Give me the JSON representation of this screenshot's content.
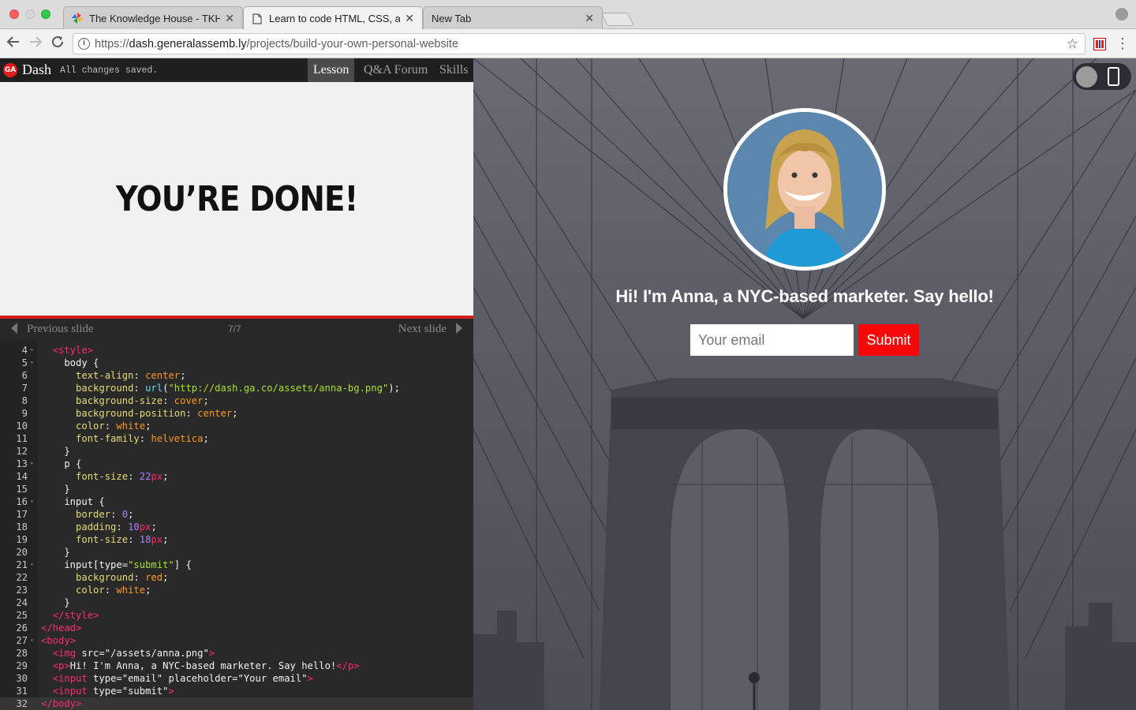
{
  "browser": {
    "tabs": [
      {
        "title": "The Knowledge House - TKH - ",
        "active": false
      },
      {
        "title": "Learn to code HTML, CSS, and",
        "active": true
      },
      {
        "title": "New Tab",
        "active": false
      }
    ],
    "url_prefix": "https://",
    "url_host": "dash.generalassemb.ly",
    "url_path": "/projects/build-your-own-personal-website"
  },
  "dash": {
    "logo": "GA",
    "title": "Dash",
    "status": "All changes saved.",
    "tabs": [
      "Lesson",
      "Q&A Forum",
      "Skills"
    ]
  },
  "slide": {
    "heading": "YOU’RE DONE!",
    "prev_label": "Previous slide",
    "next_label": "Next slide",
    "counter": "7/7"
  },
  "editor": {
    "line_numbers": [
      "4",
      "5",
      "6",
      "7",
      "8",
      "9",
      "10",
      "11",
      "12",
      "13",
      "14",
      "15",
      "16",
      "17",
      "18",
      "19",
      "20",
      "21",
      "22",
      "23",
      "24",
      "25",
      "26",
      "27",
      "28",
      "29",
      "30",
      "31",
      "32"
    ],
    "lines": [
      "  <style>",
      "    body {",
      "      text-align: center;",
      "      background: url(\"http://dash.ga.co/assets/anna-bg.png\");",
      "      background-size: cover;",
      "      background-position: center;",
      "      color: white;",
      "      font-family: helvetica;",
      "    }",
      "    p {",
      "      font-size: 22px;",
      "    }",
      "    input {",
      "      border: 0;",
      "      padding: 10px;",
      "      font-size: 18px;",
      "    }",
      "    input[type=\"submit\"] {",
      "      background: red;",
      "      color: white;",
      "    }",
      "  </style>",
      "</head>",
      "<body>",
      "  <img src=\"/assets/anna.png\">",
      "  <p>Hi! I'm Anna, a NYC-based marketer. Say hello!</p>",
      "  <input type=\"email\" placeholder=\"Your email\">",
      "  <input type=\"submit\">",
      "</body>"
    ]
  },
  "preview": {
    "greeting": "Hi! I'm Anna, a NYC-based marketer. Say hello!",
    "email_placeholder": "Your email",
    "submit_label": "Submit"
  },
  "colors": {
    "accent_red": "#f40808",
    "dash_bar": "#1f1f1f",
    "editor_bg": "#292929"
  }
}
